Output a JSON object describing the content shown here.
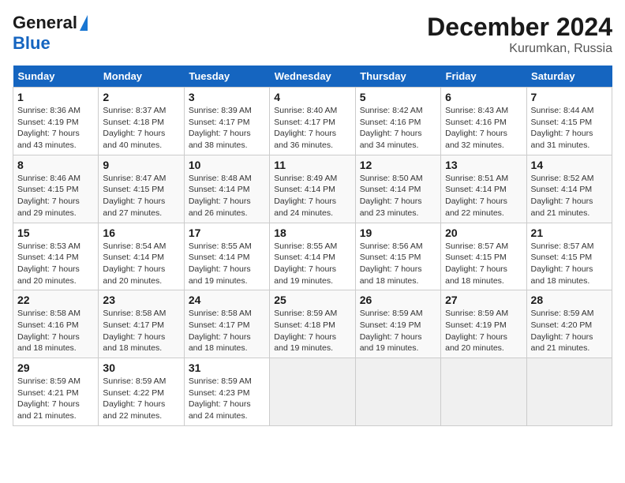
{
  "logo": {
    "line1": "General",
    "line2": "Blue"
  },
  "title": "December 2024",
  "subtitle": "Kurumkan, Russia",
  "days_of_week": [
    "Sunday",
    "Monday",
    "Tuesday",
    "Wednesday",
    "Thursday",
    "Friday",
    "Saturday"
  ],
  "weeks": [
    [
      {
        "day": 1,
        "info": "Sunrise: 8:36 AM\nSunset: 4:19 PM\nDaylight: 7 hours\nand 43 minutes."
      },
      {
        "day": 2,
        "info": "Sunrise: 8:37 AM\nSunset: 4:18 PM\nDaylight: 7 hours\nand 40 minutes."
      },
      {
        "day": 3,
        "info": "Sunrise: 8:39 AM\nSunset: 4:17 PM\nDaylight: 7 hours\nand 38 minutes."
      },
      {
        "day": 4,
        "info": "Sunrise: 8:40 AM\nSunset: 4:17 PM\nDaylight: 7 hours\nand 36 minutes."
      },
      {
        "day": 5,
        "info": "Sunrise: 8:42 AM\nSunset: 4:16 PM\nDaylight: 7 hours\nand 34 minutes."
      },
      {
        "day": 6,
        "info": "Sunrise: 8:43 AM\nSunset: 4:16 PM\nDaylight: 7 hours\nand 32 minutes."
      },
      {
        "day": 7,
        "info": "Sunrise: 8:44 AM\nSunset: 4:15 PM\nDaylight: 7 hours\nand 31 minutes."
      }
    ],
    [
      {
        "day": 8,
        "info": "Sunrise: 8:46 AM\nSunset: 4:15 PM\nDaylight: 7 hours\nand 29 minutes."
      },
      {
        "day": 9,
        "info": "Sunrise: 8:47 AM\nSunset: 4:15 PM\nDaylight: 7 hours\nand 27 minutes."
      },
      {
        "day": 10,
        "info": "Sunrise: 8:48 AM\nSunset: 4:14 PM\nDaylight: 7 hours\nand 26 minutes."
      },
      {
        "day": 11,
        "info": "Sunrise: 8:49 AM\nSunset: 4:14 PM\nDaylight: 7 hours\nand 24 minutes."
      },
      {
        "day": 12,
        "info": "Sunrise: 8:50 AM\nSunset: 4:14 PM\nDaylight: 7 hours\nand 23 minutes."
      },
      {
        "day": 13,
        "info": "Sunrise: 8:51 AM\nSunset: 4:14 PM\nDaylight: 7 hours\nand 22 minutes."
      },
      {
        "day": 14,
        "info": "Sunrise: 8:52 AM\nSunset: 4:14 PM\nDaylight: 7 hours\nand 21 minutes."
      }
    ],
    [
      {
        "day": 15,
        "info": "Sunrise: 8:53 AM\nSunset: 4:14 PM\nDaylight: 7 hours\nand 20 minutes."
      },
      {
        "day": 16,
        "info": "Sunrise: 8:54 AM\nSunset: 4:14 PM\nDaylight: 7 hours\nand 20 minutes."
      },
      {
        "day": 17,
        "info": "Sunrise: 8:55 AM\nSunset: 4:14 PM\nDaylight: 7 hours\nand 19 minutes."
      },
      {
        "day": 18,
        "info": "Sunrise: 8:55 AM\nSunset: 4:14 PM\nDaylight: 7 hours\nand 19 minutes."
      },
      {
        "day": 19,
        "info": "Sunrise: 8:56 AM\nSunset: 4:15 PM\nDaylight: 7 hours\nand 18 minutes."
      },
      {
        "day": 20,
        "info": "Sunrise: 8:57 AM\nSunset: 4:15 PM\nDaylight: 7 hours\nand 18 minutes."
      },
      {
        "day": 21,
        "info": "Sunrise: 8:57 AM\nSunset: 4:15 PM\nDaylight: 7 hours\nand 18 minutes."
      }
    ],
    [
      {
        "day": 22,
        "info": "Sunrise: 8:58 AM\nSunset: 4:16 PM\nDaylight: 7 hours\nand 18 minutes."
      },
      {
        "day": 23,
        "info": "Sunrise: 8:58 AM\nSunset: 4:17 PM\nDaylight: 7 hours\nand 18 minutes."
      },
      {
        "day": 24,
        "info": "Sunrise: 8:58 AM\nSunset: 4:17 PM\nDaylight: 7 hours\nand 18 minutes."
      },
      {
        "day": 25,
        "info": "Sunrise: 8:59 AM\nSunset: 4:18 PM\nDaylight: 7 hours\nand 19 minutes."
      },
      {
        "day": 26,
        "info": "Sunrise: 8:59 AM\nSunset: 4:19 PM\nDaylight: 7 hours\nand 19 minutes."
      },
      {
        "day": 27,
        "info": "Sunrise: 8:59 AM\nSunset: 4:19 PM\nDaylight: 7 hours\nand 20 minutes."
      },
      {
        "day": 28,
        "info": "Sunrise: 8:59 AM\nSunset: 4:20 PM\nDaylight: 7 hours\nand 21 minutes."
      }
    ],
    [
      {
        "day": 29,
        "info": "Sunrise: 8:59 AM\nSunset: 4:21 PM\nDaylight: 7 hours\nand 21 minutes."
      },
      {
        "day": 30,
        "info": "Sunrise: 8:59 AM\nSunset: 4:22 PM\nDaylight: 7 hours\nand 22 minutes."
      },
      {
        "day": 31,
        "info": "Sunrise: 8:59 AM\nSunset: 4:23 PM\nDaylight: 7 hours\nand 24 minutes."
      },
      null,
      null,
      null,
      null
    ]
  ]
}
